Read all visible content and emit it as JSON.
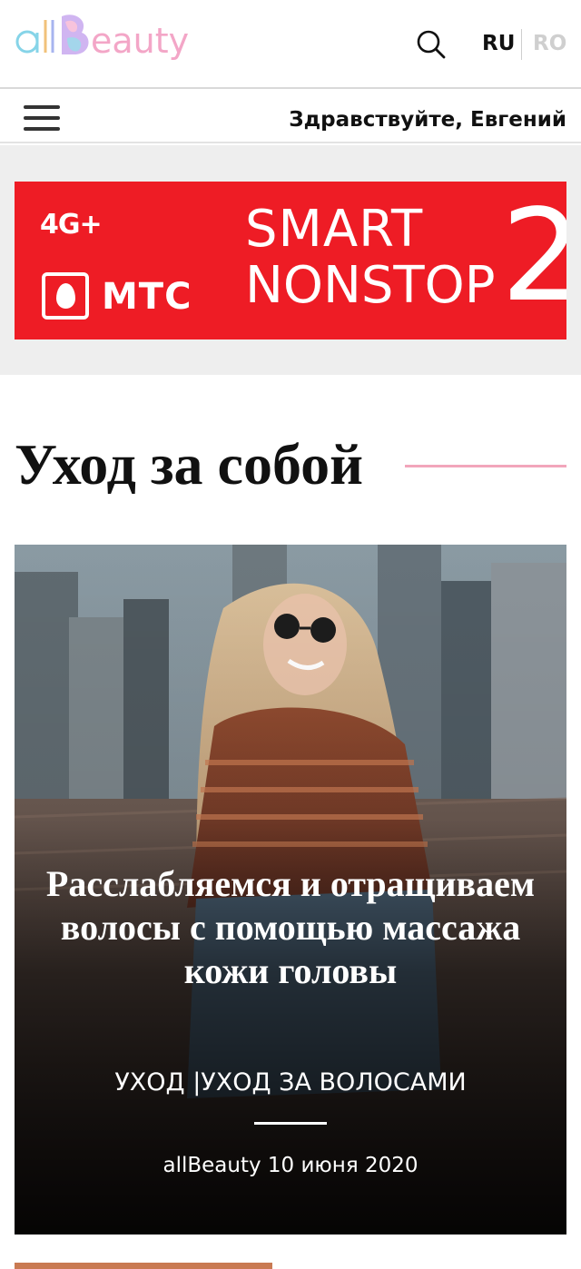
{
  "header": {
    "logo_text": "allBeauty",
    "search_icon": "search-icon",
    "languages": [
      {
        "code": "RU",
        "active": true
      },
      {
        "code": "RO",
        "active": false
      }
    ]
  },
  "subbar": {
    "menu_icon": "hamburger-menu-icon",
    "greeting": "Здравствуйте, Евгений"
  },
  "ad": {
    "network": "4G+",
    "brand": "МТС",
    "line1": "SMART",
    "line2": "NONSTOP",
    "number": "2",
    "background": "#ee1c25"
  },
  "section": {
    "title": "Уход за собой",
    "accent": "#f2a6bb"
  },
  "featured": {
    "title": "Расслабляемся и отращиваем волосы с помощью массажа кожи головы",
    "categories": [
      "УХОД",
      "УХОД ЗА ВОЛОСАМИ"
    ],
    "category_separator": " |",
    "author": "allBeauty",
    "date": "10 июня 2020"
  }
}
